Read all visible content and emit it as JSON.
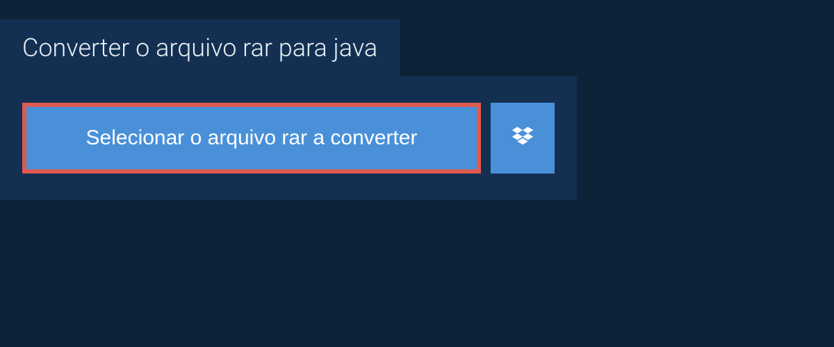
{
  "header": {
    "title": "Converter o arquivo rar para java"
  },
  "actions": {
    "select_file_label": "Selecionar o arquivo rar a converter"
  },
  "colors": {
    "background": "#0d2438",
    "panel": "#133052",
    "button": "#4a90d9",
    "highlight_border": "#e05a4f",
    "text_light": "#e8eef5"
  }
}
